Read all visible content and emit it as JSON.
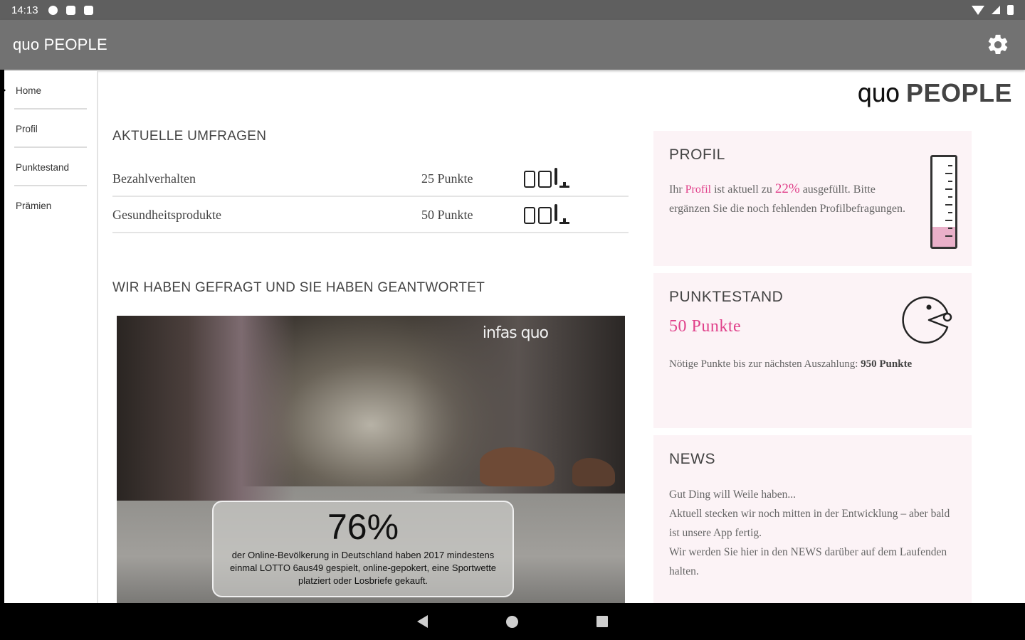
{
  "status_bar": {
    "time": "14:13",
    "icons": [
      "gear-icon",
      "notification-icon",
      "sd-card-icon",
      "wifi-icon",
      "signal-icon",
      "battery-icon"
    ]
  },
  "app_bar": {
    "title": "quo PEOPLE",
    "settings_icon": "gear-icon"
  },
  "sidebar": {
    "items": [
      {
        "label": "Home",
        "active": true
      },
      {
        "label": "Profil",
        "active": false
      },
      {
        "label": "Punktestand",
        "active": false
      },
      {
        "label": "Prämien",
        "active": false
      }
    ]
  },
  "brand": {
    "thin": "quo",
    "bold": "PEOPLE"
  },
  "surveys": {
    "title": "AKTUELLE UMFRAGEN",
    "rows": [
      {
        "name": "Bezahlverhalten",
        "points": "25 Punkte",
        "devices": [
          "phone-icon",
          "tablet-icon",
          "monitor-icon"
        ]
      },
      {
        "name": "Gesundheitsprodukte",
        "points": "50 Punkte",
        "devices": [
          "phone-icon",
          "tablet-icon",
          "monitor-icon"
        ]
      }
    ]
  },
  "answered": {
    "title": "WIR HABEN GEFRAGT UND SIE HABEN GEANTWORTET",
    "image_brand": "infas quo",
    "stat_value": "76%",
    "stat_text": "der Online-Bevölkerung in Deutschland haben 2017 mindestens einmal LOTTO 6aus49 gespielt, online-gepokert, eine Sportwette platziert oder Losbriefe gekauft."
  },
  "profil_card": {
    "title": "PROFIL",
    "text_1": "Ihr ",
    "text_link": "Profil",
    "text_2": " ist aktuell zu ",
    "percent": "22%",
    "text_3": " ausgefüllt. Bitte ergänzen Sie die noch fehlenden Profilbefragungen.",
    "fill_fraction": 0.22
  },
  "punktestand_card": {
    "title": "PUNKTESTAND",
    "points": "50 Punkte",
    "text": "Nötige Punkte bis zur nächsten Auszahlung: ",
    "needed": "950 Punkte"
  },
  "news_card": {
    "title": "NEWS",
    "lines": [
      "Gut Ding will Weile haben...",
      "Aktuell stecken wir noch mitten in der Entwicklung – aber bald ist unsere App fertig.",
      "Wir werden Sie hier in den NEWS darüber auf dem Laufenden halten."
    ]
  },
  "colors": {
    "accent": "#e0408a",
    "app_bar": "#727272",
    "card_bg": "#fcf3f6"
  }
}
